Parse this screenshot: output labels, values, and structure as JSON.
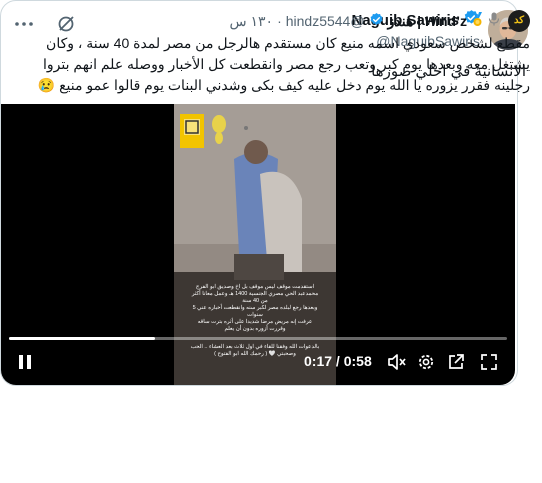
{
  "header": {
    "close_icon": "close-icon",
    "grok_icon": "grok-icon"
  },
  "author": {
    "name": "Naguib Sawiris",
    "handle": "@NaguibSawiris",
    "verified": true,
    "verified_color": "#1d9bf0"
  },
  "tweet": {
    "text": "الانسانية في احلي صورها"
  },
  "quoted": {
    "name": "Hind’z | هندز",
    "handle": "@hindz5544",
    "separator": "·",
    "time": "١٣٠ س",
    "text": "مقطع لشخص سعودي اسمه منيع كان مستقدم هالرجل من مصر لمدة 40 سنة ، وكان يشتغل معه وبعدها يوم كبر وتعب رجع مصر وانقطعت كل الأخبار ووصله علم انهم بتروا رجلينه فقرر يزوره يا الله يوم دخل عليه كيف بكى وشدني البنات يوم قالوا عمو منيع 😢"
  },
  "video": {
    "current_time": "0:17",
    "separator": "/",
    "duration": "0:58",
    "progress": 0.293,
    "captions": [
      "استقدمت موقف ليس موقف بل اخ وصديق ابو الفرج",
      "محمدعبد الحي مصري الجنسية 1400 هـ وعمل معانا أكثر",
      "من 40 سنة",
      "وبعدها رجع لبلده مصر لكبر سنه وانقطعت أخباره عني 5",
      "سنوات",
      "عرفت إنه مريض مرضا شديدا على أثره بترت ساقه",
      "وقررت أزوره بدون أن يعلم"
    ],
    "bottom_caption": [
      "بالدعوات الله وفقنا للقاء في اول ثلاث بعد العشاء .. الحب",
      "وصحبتي 🤍 ( رحمك الله ابو الفتوح )"
    ],
    "icons": [
      "pause-icon",
      "volume-icon",
      "settings-icon",
      "popout-icon",
      "fullscreen-icon"
    ]
  }
}
